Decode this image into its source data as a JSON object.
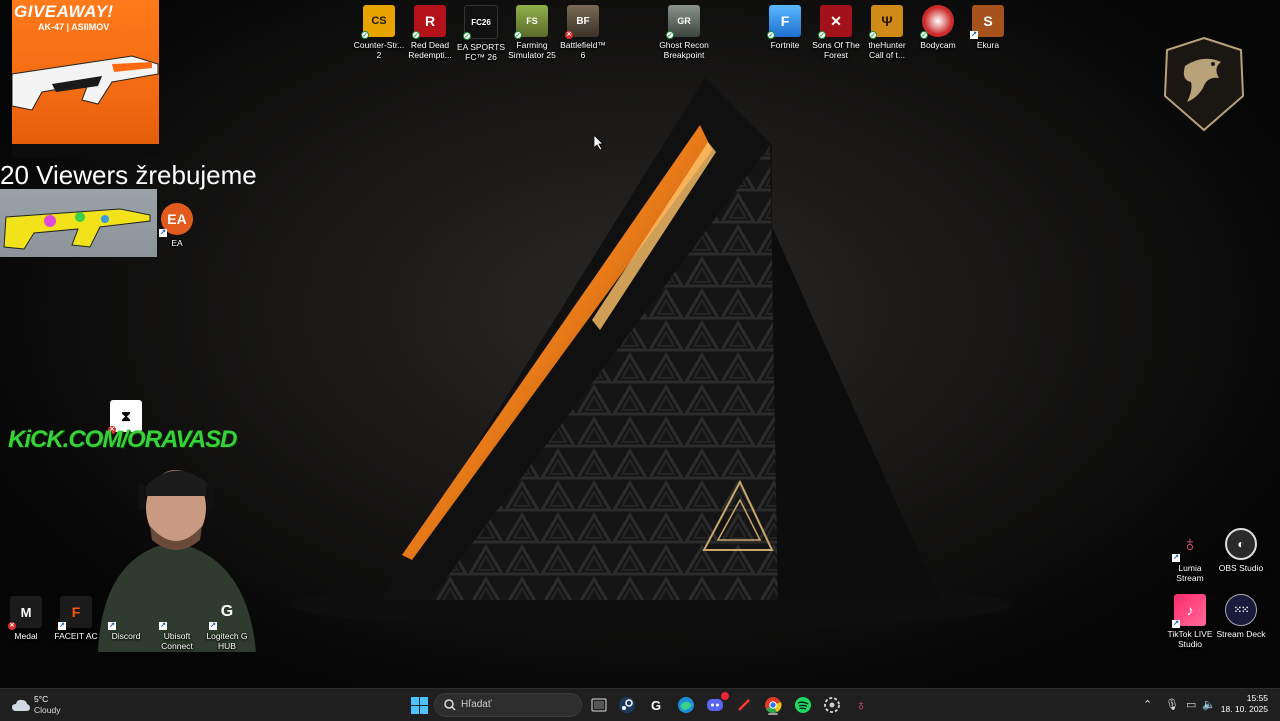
{
  "desktop": {
    "top_icons": [
      {
        "label": "Counter-Str... 2",
        "status": "ok",
        "color": "#e8a300"
      },
      {
        "label": "Red Dead Redempti...",
        "status": "ok",
        "color": "#b3121b"
      },
      {
        "label": "EA SPORTS FC™ 26",
        "status": "ok",
        "color": "#111111"
      },
      {
        "label": "Farming Simulator 25",
        "status": "ok",
        "color": "#6f8a2e"
      },
      {
        "label": "Battlefield™ 6",
        "status": "err",
        "color": "#5b4a3a"
      },
      {
        "label": "Ghost Recon Breakpoint",
        "status": "ok",
        "color": "#5c6660"
      },
      {
        "label": "Fortnite",
        "status": "ok",
        "color": "#1e88e5"
      },
      {
        "label": "Sons Of The Forest",
        "status": "ok",
        "color": "#a3121b"
      },
      {
        "label": "theHunter Call of t...",
        "status": "ok",
        "color": "#d08a18"
      },
      {
        "label": "Bodycam",
        "status": "ok",
        "color": "#cc2a2a"
      },
      {
        "label": "Ekura",
        "status": "link",
        "color": "#a5521c"
      }
    ],
    "ea_icon": {
      "label": "EA",
      "color": "#e25a1c"
    },
    "capcut_icon": {
      "label": "",
      "color": "#ffffff"
    },
    "bottom_left_icons": [
      {
        "label": "Medal",
        "status": "err"
      },
      {
        "label": "FACEIT AC",
        "status": "link"
      },
      {
        "label": "Discord",
        "status": "link"
      },
      {
        "label": "Ubisoft Connect",
        "status": "link"
      },
      {
        "label": "Logitech G HUB",
        "status": "link"
      }
    ],
    "right_icons": [
      {
        "label": "Lumia Stream",
        "status": "link"
      },
      {
        "label": "OBS Studio",
        "status": "none"
      },
      {
        "label": "TikTok LIVE Studio",
        "status": "link"
      },
      {
        "label": "Stream Deck",
        "status": "none"
      }
    ]
  },
  "overlay": {
    "giveaway_title": "GIVEAWAY!",
    "giveaway_item": "AK-47 | ASIIMOV",
    "viewers_text": "20 Viewers žrebujeme",
    "kick_text": "KiCK.COM/ORAVASD"
  },
  "taskbar": {
    "weather_temp": "5°C",
    "weather_desc": "Cloudy",
    "search_placeholder": "Hľadať",
    "time": "15:55",
    "date": "18. 10. 2025",
    "apps": [
      "task-view",
      "steam",
      "epic-games",
      "edge",
      "discord",
      "xsplit",
      "chrome",
      "spotify",
      "steelseries",
      "lumia"
    ]
  },
  "colors": {
    "accent_orange": "#ff7a1a",
    "kick_green": "#39d13a",
    "taskbar_bg": "#1f1f1f"
  }
}
